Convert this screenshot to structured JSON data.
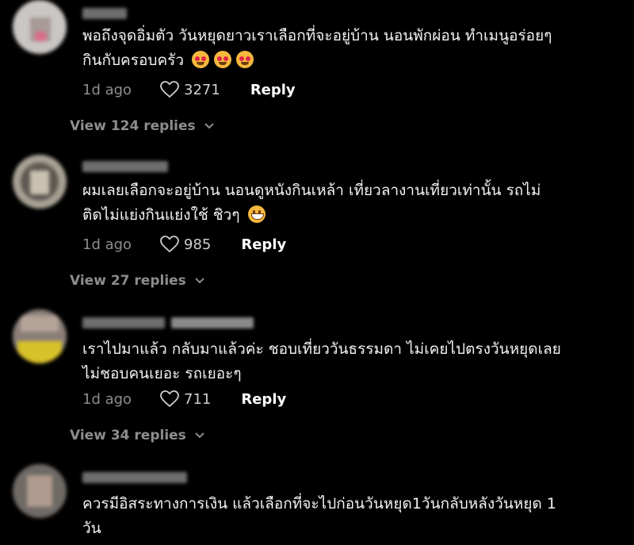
{
  "comments": [
    {
      "text_lines": [
        "พอถึงจุดอิ่มตัว วันหยุดยาวเราเลือกที่จะอยู่บ้าน นอนพักผ่อน ทำเมนูอร่อยๆ",
        "กินกับครอบครัว"
      ],
      "emojis": [
        "smiling-face-with-heart-eyes",
        "smiling-face-with-heart-eyes",
        "smiling-face-with-heart-eyes"
      ],
      "time": "1d ago",
      "likes": "3271",
      "reply_label": "Reply",
      "view_replies": "View 124 replies"
    },
    {
      "text_lines": [
        "ผมเลยเลือกจะอยู่บ้าน นอนดูหนังกินเหล้า เที่ยวลางานเที่ยวเท่านั้น รถไม่",
        "ติดไม่แย่งกินแย่งใช้ ชิวๆ"
      ],
      "emojis": [
        "grinning-face"
      ],
      "time": "1d ago",
      "likes": "985",
      "reply_label": "Reply",
      "view_replies": "View 27 replies"
    },
    {
      "text_lines": [
        "เราไปมาแล้ว กลับมาแล้วค่ะ ชอบเที่ยววันธรรมดา ไม่เคยไปตรงวันหยุดเลย",
        "ไม่ชอบคนเยอะ รถเยอะๆ"
      ],
      "emojis": [],
      "time": "1d ago",
      "likes": "711",
      "reply_label": "Reply",
      "view_replies": "View 34 replies"
    },
    {
      "text_lines": [
        "ควรมีอิสระทางการเงิน แล้วเลือกที่จะไปก่อนวันหยุด1วันกลับหลังวันหยุด 1",
        "วัน"
      ],
      "emojis": [],
      "time": "",
      "likes": "",
      "reply_label": "",
      "view_replies": ""
    }
  ],
  "colors": {
    "background": "#000000",
    "text": "#f2f2f2",
    "muted": "#8d8d8d",
    "reply": "#ffffff"
  }
}
